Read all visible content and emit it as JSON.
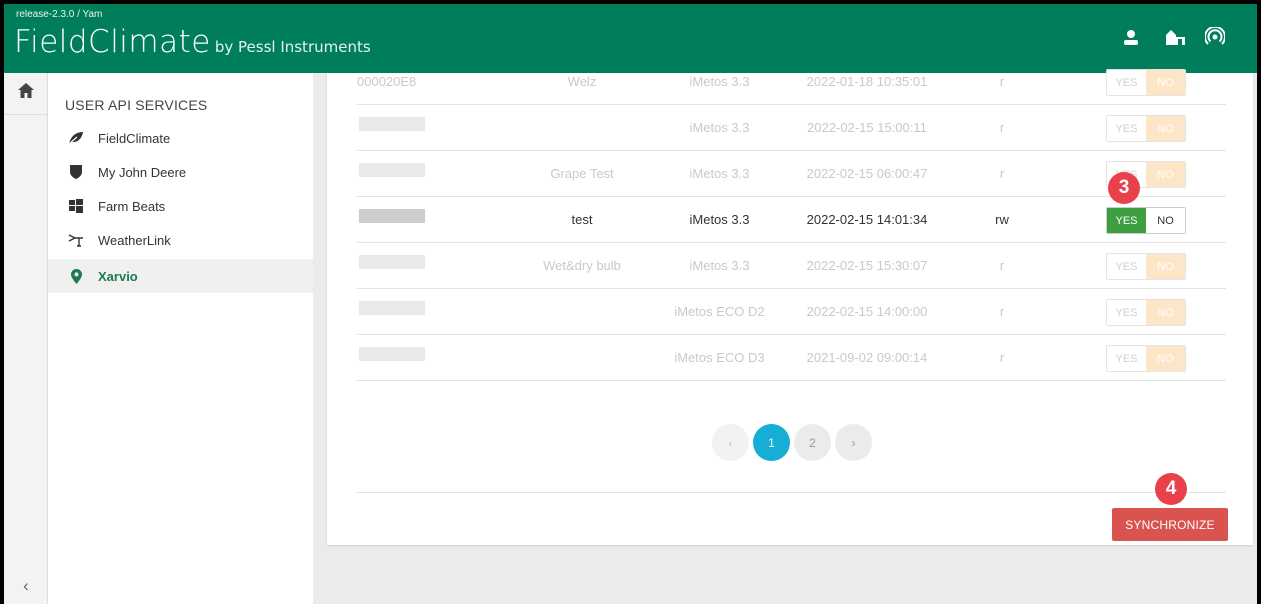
{
  "app": {
    "release": "release-2.3.0 / Yam",
    "logo_main": "FieldClimate",
    "logo_by": "by Pessl Instruments"
  },
  "header_icons": [
    "user-icon",
    "farm-icon",
    "station-signal-icon"
  ],
  "sidebar": {
    "title": "USER API SERVICES",
    "items": [
      {
        "label": "FieldClimate",
        "icon": "leaf-icon",
        "active": false
      },
      {
        "label": "My John Deere",
        "icon": "shield-icon",
        "active": false
      },
      {
        "label": "Farm Beats",
        "icon": "windows-icon",
        "active": false
      },
      {
        "label": "WeatherLink",
        "icon": "weather-station-icon",
        "active": false
      },
      {
        "label": "Xarvio",
        "icon": "map-marker-icon",
        "active": true
      }
    ]
  },
  "table": {
    "rows": [
      {
        "id": "000020E8",
        "name": "Welz",
        "model": "iMetos 3.3",
        "date": "2022-01-18 10:35:01",
        "permission": "r",
        "yes": "YES",
        "no": "NO",
        "selected": "NO",
        "state": "faded"
      },
      {
        "id": "",
        "name": "",
        "model": "iMetos 3.3",
        "date": "2022-02-15 15:00:11",
        "permission": "r",
        "yes": "YES",
        "no": "NO",
        "selected": "NO",
        "state": "faded"
      },
      {
        "id": "",
        "name": "Grape Test",
        "model": "iMetos 3.3",
        "date": "2022-02-15 06:00:47",
        "permission": "r",
        "yes": "YES",
        "no": "NO",
        "selected": "NO",
        "state": "faded"
      },
      {
        "id": "",
        "name": "test",
        "model": "iMetos 3.3",
        "date": "2022-02-15 14:01:34",
        "permission": "rw",
        "yes": "YES",
        "no": "NO",
        "selected": "YES",
        "state": "active"
      },
      {
        "id": "",
        "name": "Wet&dry bulb",
        "model": "iMetos 3.3",
        "date": "2022-02-15 15:30:07",
        "permission": "r",
        "yes": "YES",
        "no": "NO",
        "selected": "NO",
        "state": "faded"
      },
      {
        "id": "",
        "name": "",
        "model": "iMetos ECO D2",
        "date": "2022-02-15 14:00:00",
        "permission": "r",
        "yes": "YES",
        "no": "NO",
        "selected": "NO",
        "state": "faded"
      },
      {
        "id": "",
        "name": "",
        "model": "iMetos ECO D3",
        "date": "2021-09-02 09:00:14",
        "permission": "r",
        "yes": "YES",
        "no": "NO",
        "selected": "NO",
        "state": "faded"
      }
    ]
  },
  "pagination": {
    "prev": "‹",
    "pages": [
      "1",
      "2"
    ],
    "current": "1",
    "next": "›"
  },
  "actions": {
    "synchronize": "SYNCHRONIZE"
  },
  "markers": {
    "step3": "3",
    "step4": "4"
  },
  "colors": {
    "header": "#007e5c",
    "accent_green": "#3f9e3f",
    "pager_active": "#16aed5",
    "sync_button": "#d9534f",
    "marker": "#e8414b"
  }
}
